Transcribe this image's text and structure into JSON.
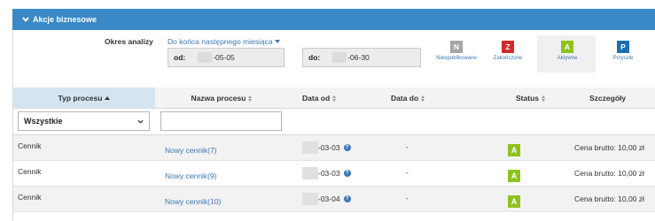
{
  "header": {
    "title": "Akcje biznesowe"
  },
  "filters": {
    "period_label": "Okres analizy",
    "period_value": "Do końca następnego miesiąca",
    "date_from": {
      "label": "od:",
      "value": "-05-05"
    },
    "date_to": {
      "label": "do:",
      "value": "-06-30"
    }
  },
  "status_legend": [
    {
      "letter": "N",
      "caption": "Nieopublikowane",
      "color": "#a6a6a6"
    },
    {
      "letter": "Z",
      "caption": "Zakończone",
      "color": "#d42a2a"
    },
    {
      "letter": "A",
      "caption": "Aktywne",
      "color": "#8dc21f"
    },
    {
      "letter": "P",
      "caption": "Przyszłe",
      "color": "#1f6fb0"
    }
  ],
  "table": {
    "columns": [
      "Typ procesu",
      "Nazwa procesu",
      "Data od",
      "Data do",
      "Status",
      "Szczegóły"
    ],
    "type_filter_value": "Wszystkie",
    "rows": [
      {
        "type": "Cennik",
        "name": "Nowy cennik(7)",
        "date_from": "-03-03",
        "date_to": "-",
        "status": "A",
        "details": "Cena brutto: 10,00 zł"
      },
      {
        "type": "Cennik",
        "name": "Nowy cennik(9)",
        "date_from": "-03-03",
        "date_to": "-",
        "status": "A",
        "details": "Cena brutto: 10,00 zł"
      },
      {
        "type": "Cennik",
        "name": "Nowy cennik(10)",
        "date_from": "-03-04",
        "date_to": "-",
        "status": "A",
        "details": "Cena brutto: 10,00 zł"
      }
    ]
  }
}
